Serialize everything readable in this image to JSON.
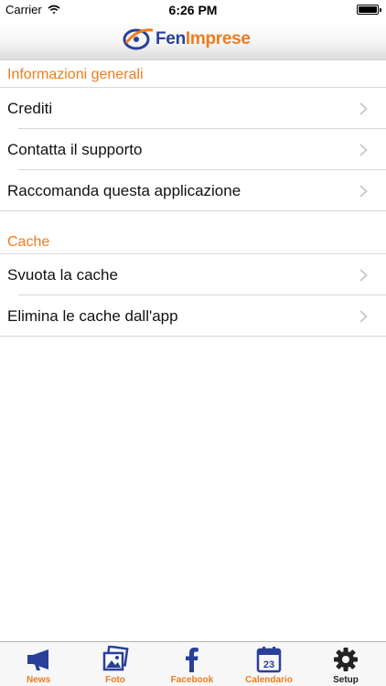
{
  "status_bar": {
    "carrier": "Carrier",
    "time": "6:26 PM"
  },
  "nav_bar": {
    "logo_part1": "Fen",
    "logo_part2": "Imprese"
  },
  "sections": [
    {
      "header": "Informazioni generali",
      "rows": [
        "Crediti",
        "Contatta il supporto",
        "Raccomanda questa applicazione"
      ]
    },
    {
      "header": "Cache",
      "rows": [
        "Svuota la cache",
        "Elimina le cache dall'app"
      ]
    }
  ],
  "tabs": [
    {
      "label": "News",
      "icon": "megaphone-icon"
    },
    {
      "label": "Foto",
      "icon": "photos-icon"
    },
    {
      "label": "Facebook",
      "icon": "facebook-icon"
    },
    {
      "label": "Calendario",
      "icon": "calendar-icon",
      "calendar_day": "23"
    },
    {
      "label": "Setup",
      "icon": "gear-icon"
    }
  ],
  "colors": {
    "accent": "#ee7c1c",
    "brand_blue": "#2a3f9a",
    "active_tab": "#222222"
  }
}
